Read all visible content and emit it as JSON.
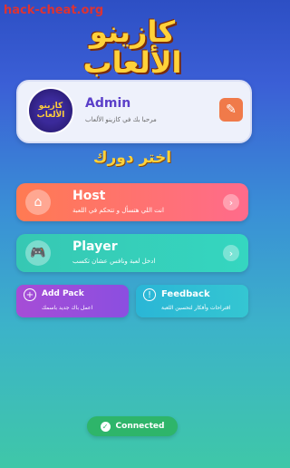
{
  "watermark": "hack-cheat.org",
  "logo": {
    "line1": "كازينو",
    "line2": "الألعاب"
  },
  "profile": {
    "avatar_line1": "كازينو",
    "avatar_line2": "الألعاب",
    "name": "Admin",
    "welcome": "مرحبا بك في كازينو الألعاب",
    "edit_icon": "pencil-icon"
  },
  "choose_role": "اختر دورك",
  "host": {
    "title": "Host",
    "subtitle": "انت اللي هتسأل و تتحكم في اللعبة",
    "icon": "host-icon",
    "arrow": "›"
  },
  "player": {
    "title": "Player",
    "subtitle": "ادخل لعبة ونافس عشان تكسب",
    "icon": "gamepad-icon",
    "arrow": "›"
  },
  "add_pack": {
    "title": "Add Pack",
    "subtitle": "اعمل باك جديد باسمك",
    "icon": "plus-circle-icon"
  },
  "feedback": {
    "title": "Feedback",
    "subtitle": "اقتراحات وأفكار لتحسين اللعبة",
    "icon": "lightbulb-icon"
  },
  "status": {
    "label": "Connected",
    "color": "#2eb56a"
  }
}
